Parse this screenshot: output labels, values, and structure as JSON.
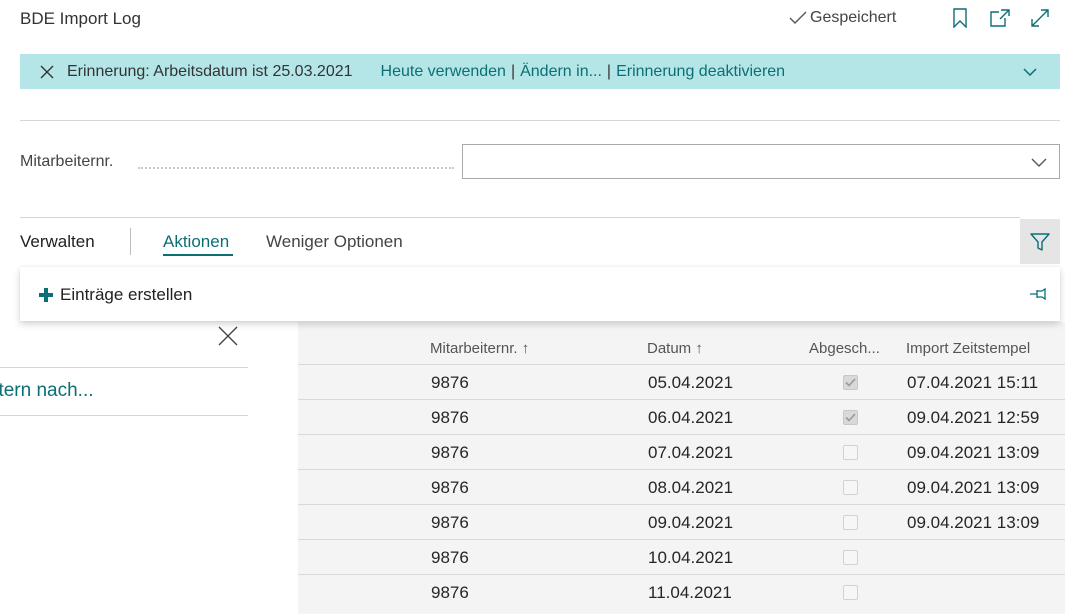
{
  "header": {
    "title": "BDE Import Log",
    "saved_label": "Gespeichert"
  },
  "reminder": {
    "text": "Erinnerung: Arbeitsdatum ist 25.03.2021",
    "links": [
      "Heute verwenden",
      "Ändern in...",
      "Erinnerung deaktivieren"
    ],
    "separator": "|"
  },
  "field": {
    "label": "Mitarbeiternr.",
    "value": ""
  },
  "action_bar": {
    "manage": "Verwalten",
    "actions": "Aktionen",
    "fewer": "Weniger Optionen"
  },
  "popup": {
    "item_label": "Einträge erstellen"
  },
  "filter_pane": {
    "filter_label": "iltern nach..."
  },
  "grid": {
    "columns": [
      "Mitarbeiternr.",
      "Datum",
      "Abgesch...",
      "Import Zeitstempel"
    ],
    "sort_indicator": "↑",
    "rows": [
      {
        "mitarbeiternr": "9876",
        "datum": "05.04.2021",
        "abgeschlossen": true,
        "zeitstempel": "07.04.2021 15:11"
      },
      {
        "mitarbeiternr": "9876",
        "datum": "06.04.2021",
        "abgeschlossen": true,
        "zeitstempel": "09.04.2021 12:59"
      },
      {
        "mitarbeiternr": "9876",
        "datum": "07.04.2021",
        "abgeschlossen": false,
        "zeitstempel": "09.04.2021 13:09"
      },
      {
        "mitarbeiternr": "9876",
        "datum": "08.04.2021",
        "abgeschlossen": false,
        "zeitstempel": "09.04.2021 13:09"
      },
      {
        "mitarbeiternr": "9876",
        "datum": "09.04.2021",
        "abgeschlossen": false,
        "zeitstempel": "09.04.2021 13:09"
      },
      {
        "mitarbeiternr": "9876",
        "datum": "10.04.2021",
        "abgeschlossen": false,
        "zeitstempel": ""
      },
      {
        "mitarbeiternr": "9876",
        "datum": "11.04.2021",
        "abgeschlossen": false,
        "zeitstempel": ""
      }
    ]
  },
  "colors": {
    "accent": "#0b6f74",
    "banner_bg": "#b4e6e8",
    "plus_icon": "#0b6f74"
  }
}
